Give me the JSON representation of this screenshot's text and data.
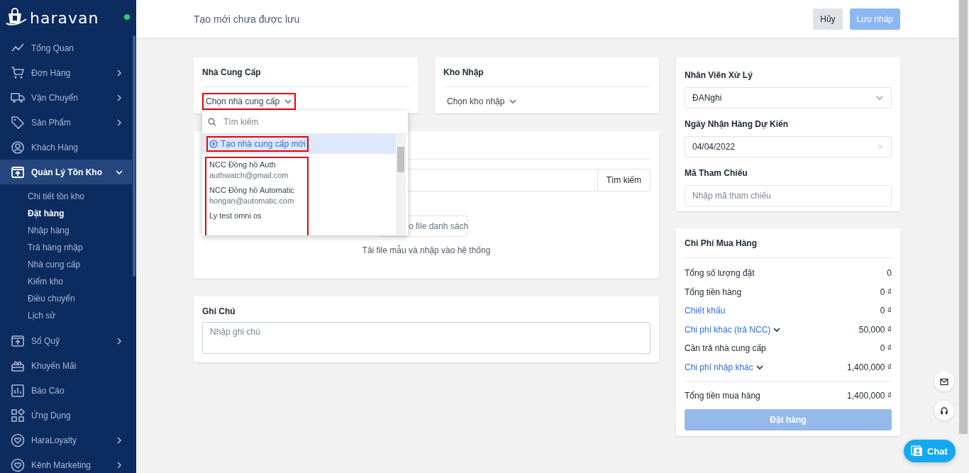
{
  "brand": {
    "name": "haravan",
    "online": true
  },
  "sidebar": {
    "items": [
      {
        "label": "Tổng Quan",
        "has_children": false,
        "selected": false
      },
      {
        "label": "Đơn Hàng",
        "has_children": true,
        "expanded": false,
        "selected": false
      },
      {
        "label": "Vận Chuyển",
        "has_children": true,
        "expanded": false,
        "selected": false
      },
      {
        "label": "Sản Phẩm",
        "has_children": true,
        "expanded": false,
        "selected": false
      },
      {
        "label": "Khách Hàng",
        "has_children": false,
        "selected": false
      },
      {
        "label": "Quản Lý Tồn Kho",
        "has_children": true,
        "expanded": true,
        "selected": true,
        "children": [
          {
            "label": "Chi tiết tồn kho",
            "selected": false
          },
          {
            "label": "Đặt hàng",
            "selected": true
          },
          {
            "label": "Nhập hàng",
            "selected": false
          },
          {
            "label": "Trả hàng nhập",
            "selected": false
          },
          {
            "label": "Nhà cung cấp",
            "selected": false
          },
          {
            "label": "Kiểm kho",
            "selected": false
          },
          {
            "label": "Điều chuyển",
            "selected": false
          },
          {
            "label": "Lịch sử",
            "selected": false
          }
        ]
      },
      {
        "label": "Sổ Quỹ",
        "has_children": true,
        "expanded": false,
        "selected": false
      },
      {
        "label": "Khuyến Mãi",
        "has_children": false,
        "selected": false
      },
      {
        "label": "Báo Cáo",
        "has_children": false,
        "selected": false
      },
      {
        "label": "Ứng Dụng",
        "has_children": false,
        "selected": false
      },
      {
        "label": "HaraLoyalty",
        "has_children": true,
        "expanded": false,
        "selected": false
      },
      {
        "label": "Kênh Marketing",
        "has_children": true,
        "expanded": false,
        "selected": false
      }
    ]
  },
  "header": {
    "title": "Tạo mới chưa được lưu",
    "buttons": [
      {
        "label": "Hủy",
        "kind": "secondary",
        "disabled": false
      },
      {
        "label": "Lưu nháp",
        "kind": "primary",
        "disabled": true
      }
    ]
  },
  "supplier_card": {
    "title": "Nhà Cung Cấp",
    "select": {
      "placeholder": "Chọn nhà cung cấp",
      "highlighted": true
    },
    "dropdown": {
      "search_placeholder": "Tìm kiếm",
      "create_option": {
        "label": "Tạo nhà cung cấp mới",
        "highlighted": true
      },
      "options_highlighted": true,
      "options": [
        {
          "name": "NCC Đồng hồ Auth",
          "email": "authwatch@gmail.com"
        },
        {
          "name": "NCC Đồng hồ Automatic",
          "email": "hongan@automatic.com"
        },
        {
          "name": "Ly test omni os"
        }
      ]
    }
  },
  "warehouse_card": {
    "title": "Kho Nhập",
    "select": {
      "placeholder": "Chọn kho nhập",
      "highlighted": false
    }
  },
  "product_card": {
    "search_button": "Tìm kiếm",
    "import_button": "o file danh sách",
    "hint": "Tải file mẫu và nhập vào hệ thống"
  },
  "note_card": {
    "title": "Ghi Chú",
    "placeholder": "Nhập ghi chú"
  },
  "details_card": {
    "fields": [
      {
        "label": "Nhân Viên Xử Lý",
        "kind": "select",
        "value": "ĐANghi"
      },
      {
        "label": "Ngày Nhận Hàng Dự Kiến",
        "kind": "date",
        "value": "04/04/2022"
      },
      {
        "label": "Mã Tham Chiếu",
        "kind": "text",
        "placeholder": "Nhập mã tham chiếu"
      }
    ]
  },
  "cost_card": {
    "title": "Chi Phí Mua Hàng",
    "rows": [
      {
        "label": "Tổng số lượng đặt",
        "value": "0",
        "kind": "plain"
      },
      {
        "label": "Tổng tiền hàng",
        "value": "0 ₫",
        "kind": "plain"
      },
      {
        "label": "Chiết khấu",
        "value": "0 ₫",
        "kind": "link"
      },
      {
        "label": "Chi phí khác (trả NCC)",
        "value": "50,000 ₫",
        "kind": "dropdown"
      },
      {
        "label": "Cần trả nhà cung cấp",
        "value": "0 ₫",
        "kind": "plain"
      },
      {
        "label": "Chi phí nhập khác",
        "value": "1,400,000 ₫",
        "kind": "dropdown"
      }
    ],
    "total": {
      "label": "Tổng tiền mua hàng",
      "value": "1,400,000 ₫"
    },
    "button": {
      "label": "Đặt hàng",
      "disabled": true
    }
  },
  "chat": {
    "label": "Chat"
  }
}
